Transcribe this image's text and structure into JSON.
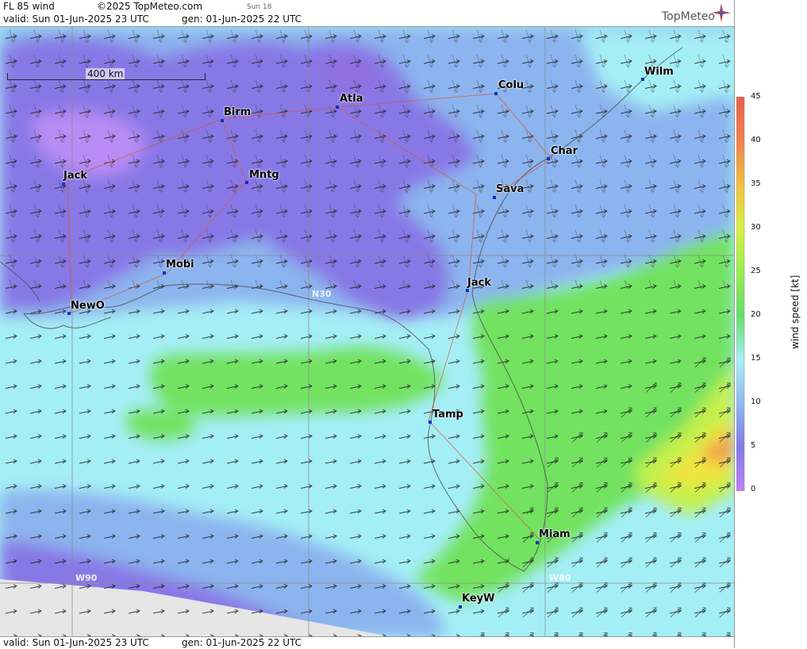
{
  "header": {
    "product": "FL 85 wind",
    "copyright": "©2025 TopMeteo.com",
    "sun_label": "Sun 18",
    "valid": "valid:  Sun  01-Jun-2025  23 UTC",
    "generated": "gen: 01-Jun-2025 22 UTC",
    "brand": "TopMeteo"
  },
  "footer": {
    "valid": "valid:  Sun  01-Jun-2025  23 UTC",
    "generated": "gen: 01-Jun-2025 22 UTC"
  },
  "map": {
    "scale_bar": "400 km",
    "lon_labels": [
      "W90",
      "W80"
    ],
    "lat_labels": [
      "N30"
    ],
    "cities": [
      "Jack",
      "Birm",
      "Atla",
      "Colu",
      "Wilm",
      "Char",
      "Mntg",
      "Sava",
      "Mobi",
      "Jack",
      "NewO",
      "Tamp",
      "Miam",
      "KeyW"
    ],
    "prevailing_flow": "south-westerly to westerly"
  },
  "colorbar": {
    "label": "wind speed [kt]",
    "ticks": [
      "45",
      "40",
      "35",
      "30",
      "25",
      "20",
      "15",
      "10",
      "5",
      "0"
    ],
    "colors": [
      "#e8604a",
      "#f2a04a",
      "#f0e040",
      "#c8f050",
      "#78e858",
      "#60e070",
      "#a8f0f8",
      "#90b8f0",
      "#8078e8",
      "#c080f8"
    ]
  }
}
